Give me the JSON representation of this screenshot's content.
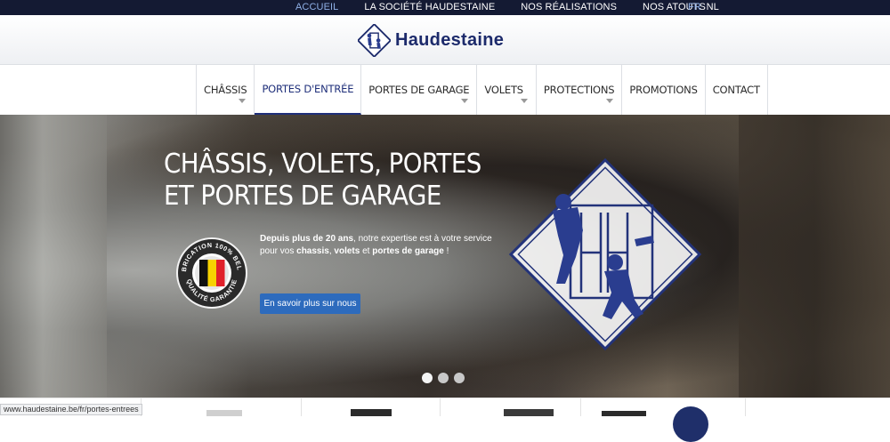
{
  "topnav": {
    "links": [
      "ACCUEIL",
      "LA SOCIÉTÉ HAUDESTAINE",
      "NOS RÉALISATIONS",
      "NOS ATOUTS"
    ],
    "languages": [
      "FR",
      "NL"
    ]
  },
  "header": {
    "logo_text": "Haudestaine"
  },
  "menu": {
    "items": [
      "CHÂSSIS",
      "PORTES D'ENTRÉE",
      "PORTES DE GARAGE",
      "VOLETS",
      "PROTECTIONS",
      "PROMOTIONS",
      "CONTACT"
    ],
    "active": "PORTES D'ENTRÉE"
  },
  "hero": {
    "title_line1": "CHÂSSIS, VOLETS, PORTES",
    "title_line2": "ET PORTES DE GARAGE",
    "text_part1": "Depuis plus de 20 ans",
    "text_part2": ", notre expertise est à votre service pour vos ",
    "text_part3": "chassis",
    "text_part4": ", ",
    "text_part5": "volets",
    "text_part6": " et ",
    "text_part7": "portes de garage",
    "text_part8": " !",
    "cta": "En savoir plus sur nous",
    "badge_top": "FABRICATION 100% BELGE",
    "badge_bottom": "QUALITÉ GARANTIE",
    "slides": 3,
    "active_slide": 1
  },
  "status_bar": {
    "url": "www.haudestaine.be/fr/portes-entrees"
  },
  "colors": {
    "brand_navy": "#1c2a6b",
    "cta_blue": "#2d6bbd",
    "top_bar": "#141a33",
    "lang_active": "#8fb0e6"
  }
}
